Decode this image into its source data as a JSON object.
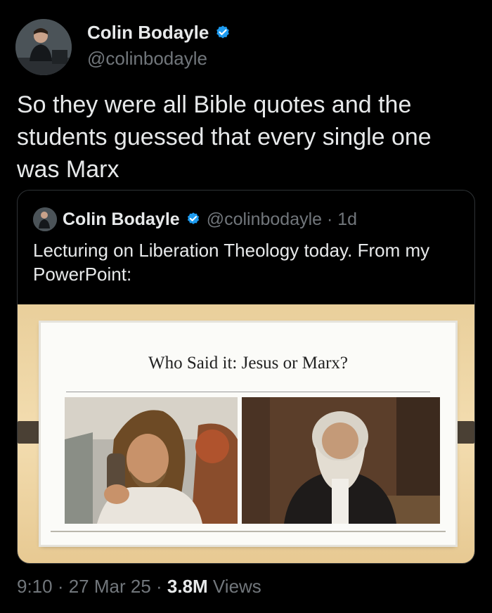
{
  "tweet": {
    "author_name": "Colin Bodayle",
    "handle": "@colinbodayle",
    "text": "So they were all Bible quotes and the students guessed that every single one was Marx"
  },
  "quoted_tweet": {
    "author_name": "Colin Bodayle",
    "handle_time": "@colinbodayle · 1d",
    "text": "Lecturing on Liberation Theology today. From my PowerPoint:",
    "slide": {
      "title": "Who Said it: Jesus or Marx?"
    }
  },
  "footer": {
    "time_date": "9:10 · 27 Mar 25 · ",
    "views_count": "3.8M",
    "views_label": " Views"
  },
  "colors": {
    "background": "#000000",
    "text": "#e7e9ea",
    "secondary": "#71767b",
    "verified": "#1d9bf0"
  },
  "icons": [
    "verified-badge-icon"
  ]
}
